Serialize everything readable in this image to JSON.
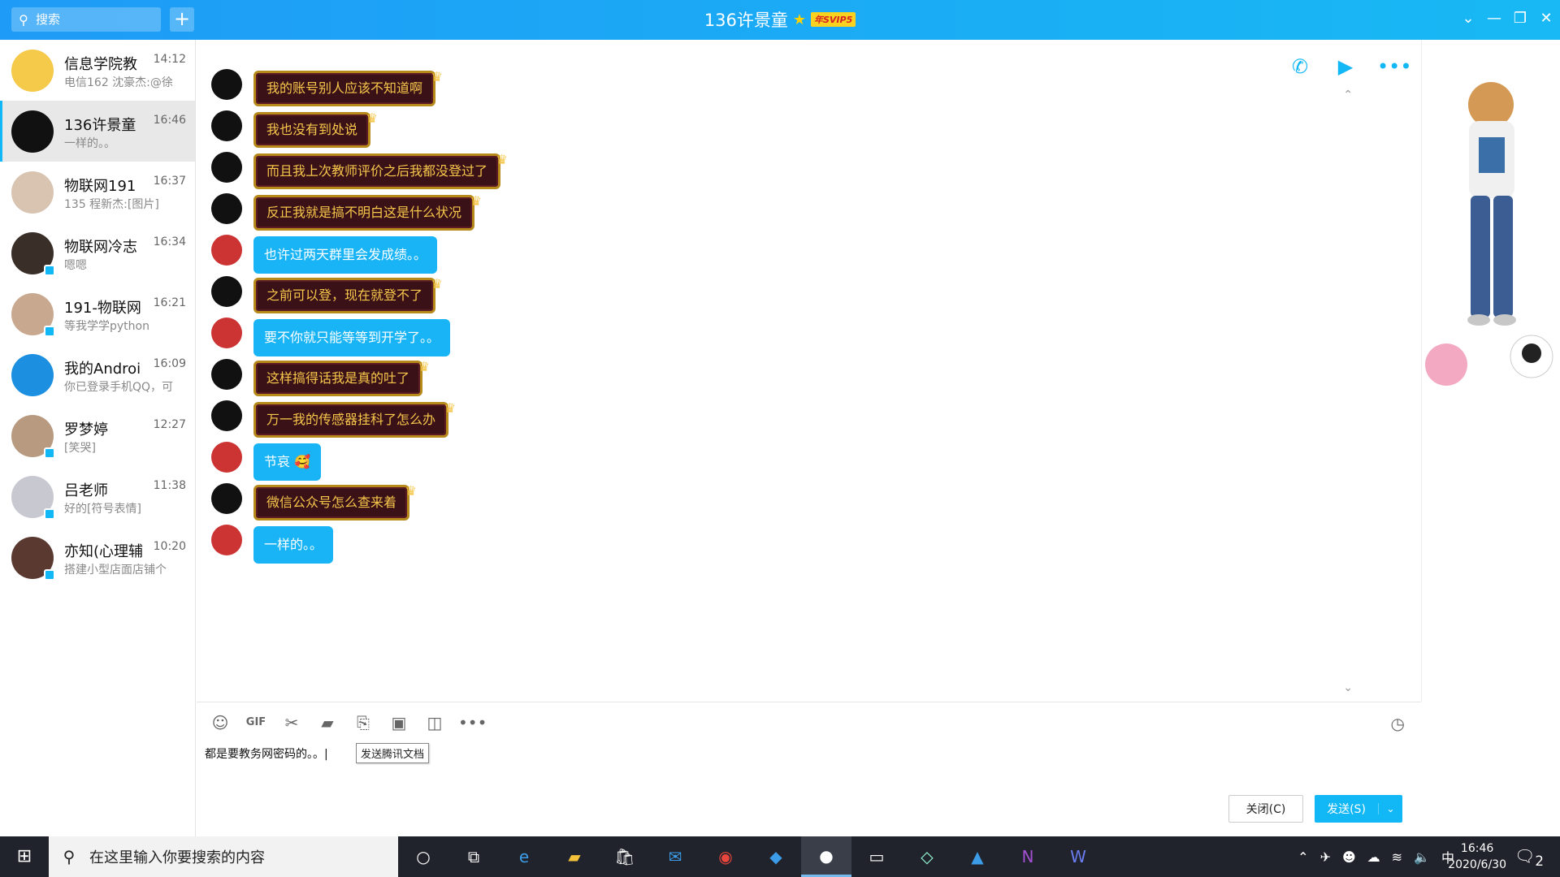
{
  "window": {
    "title": "136许景童",
    "vip_badge": "年SVIP5",
    "search_placeholder": "搜索"
  },
  "conversations": [
    {
      "name": "信息学院教",
      "time": "14:12",
      "preview": "电信162 沈豪杰:@徐",
      "avatar_color": "#f5c94a",
      "active": false,
      "phone": false
    },
    {
      "name": "136许景童",
      "time": "16:46",
      "preview": "一样的。。",
      "avatar_color": "#111111",
      "active": true,
      "phone": false
    },
    {
      "name": "物联网191",
      "time": "16:37",
      "preview": "135 程新杰:[图片]",
      "avatar_color": "#d8c4b0",
      "active": false,
      "phone": false
    },
    {
      "name": "物联网冷志",
      "time": "16:34",
      "preview": "嗯嗯",
      "avatar_color": "#3a2e28",
      "active": false,
      "phone": true
    },
    {
      "name": "191-物联网",
      "time": "16:21",
      "preview": "等我学学python",
      "avatar_color": "#c9a890",
      "active": false,
      "phone": true
    },
    {
      "name": "我的Androi",
      "time": "16:09",
      "preview": "你已登录手机QQ，可",
      "avatar_color": "#1c8fe0",
      "active": false,
      "phone": false
    },
    {
      "name": "罗梦婷",
      "time": "12:27",
      "preview": "[笑哭]",
      "avatar_color": "#b89a80",
      "active": false,
      "phone": true
    },
    {
      "name": "吕老师",
      "time": "11:38",
      "preview": "好的[符号表情]",
      "avatar_color": "#c8c8d0",
      "active": false,
      "phone": true
    },
    {
      "name": "亦知(心理辅",
      "time": "10:20",
      "preview": "搭建小型店面店铺个",
      "avatar_color": "#5a3a30",
      "active": false,
      "phone": true
    }
  ],
  "messages": [
    {
      "from": "theirs",
      "text": "我的账号别人应该不知道啊"
    },
    {
      "from": "theirs",
      "text": "我也没有到处说"
    },
    {
      "from": "theirs",
      "text": "而且我上次教师评价之后我都没登过了"
    },
    {
      "from": "theirs",
      "text": "反正我就是搞不明白这是什么状况"
    },
    {
      "from": "mine",
      "text": "也许过两天群里会发成绩。。"
    },
    {
      "from": "theirs",
      "text": "之前可以登，现在就登不了"
    },
    {
      "from": "mine",
      "text": "要不你就只能等等到开学了。。"
    },
    {
      "from": "theirs",
      "text": "这样搞得话我是真的吐了"
    },
    {
      "from": "theirs",
      "text": "万一我的传感器挂科了怎么办"
    },
    {
      "from": "mine",
      "text": "节哀 🥰"
    },
    {
      "from": "theirs",
      "text": "微信公众号怎么查来着"
    },
    {
      "from": "mine",
      "text": "一样的。。"
    }
  ],
  "composer": {
    "draft": "都是要教务网密码的。。",
    "tooltip": "发送腾讯文档",
    "close_label": "关闭(C)",
    "send_label": "发送(S)"
  },
  "taskbar": {
    "search_placeholder": "在这里输入你要搜索的内容",
    "time": "16:46",
    "date": "2020/6/30",
    "ime": "中",
    "notifications": "2"
  }
}
